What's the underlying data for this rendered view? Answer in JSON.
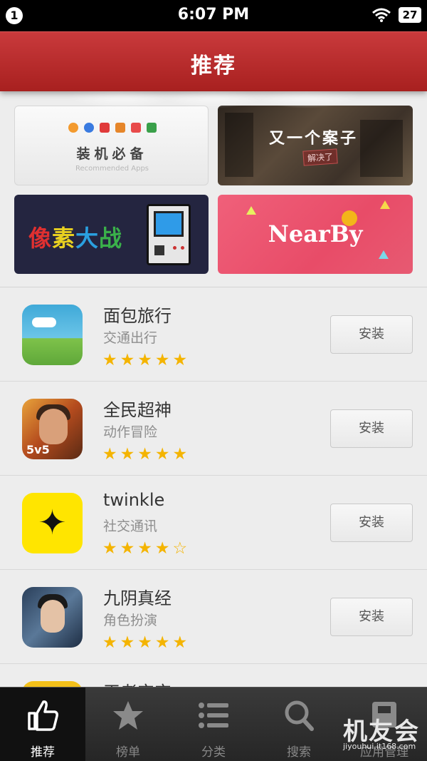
{
  "status_bar": {
    "notification_count": "1",
    "time": "6:07 PM",
    "battery": "27"
  },
  "header": {
    "title": "推荐"
  },
  "banners": {
    "essentials": {
      "title": "装机必备",
      "subtitle": "Recommended Apps"
    },
    "mystery": {
      "title": "又一个案子",
      "stamp": "解决了"
    },
    "pixel_war": {
      "title_chars": [
        "像",
        "素",
        "大",
        "战"
      ]
    },
    "nearby": {
      "title": "NearBy"
    }
  },
  "apps": [
    {
      "name": "面包旅行",
      "category": "交通出行",
      "stars": "★★★★★",
      "rating": 5,
      "install_label": "安装"
    },
    {
      "name": "全民超神",
      "category": "动作冒险",
      "stars": "★★★★★",
      "rating": 5,
      "install_label": "安装",
      "icon_tag": "5v5"
    },
    {
      "name": "twinkle",
      "category": "社交通讯",
      "stars": "★★★★☆",
      "rating": 4.5,
      "install_label": "安装"
    },
    {
      "name": "九阴真经",
      "category": "角色扮演",
      "stars": "★★★★★",
      "rating": 5,
      "install_label": "安装"
    },
    {
      "name": "王者宝宝",
      "category": "",
      "stars": "",
      "rating": null,
      "install_label": ""
    }
  ],
  "tabs": [
    {
      "label": "推荐",
      "icon": "thumbs-up-icon",
      "active": true
    },
    {
      "label": "榜单",
      "icon": "star-icon",
      "active": false
    },
    {
      "label": "分类",
      "icon": "list-icon",
      "active": false
    },
    {
      "label": "搜索",
      "icon": "search-icon",
      "active": false
    },
    {
      "label": "应用管理",
      "icon": "app-manage-icon",
      "active": false
    }
  ],
  "watermark": {
    "logo": "机友会",
    "url": "jiyouhui.it168.com"
  },
  "colors": {
    "header_red": "#b52a2a",
    "star_gold": "#f4b400",
    "tab_bar": "#2e2e2e"
  }
}
